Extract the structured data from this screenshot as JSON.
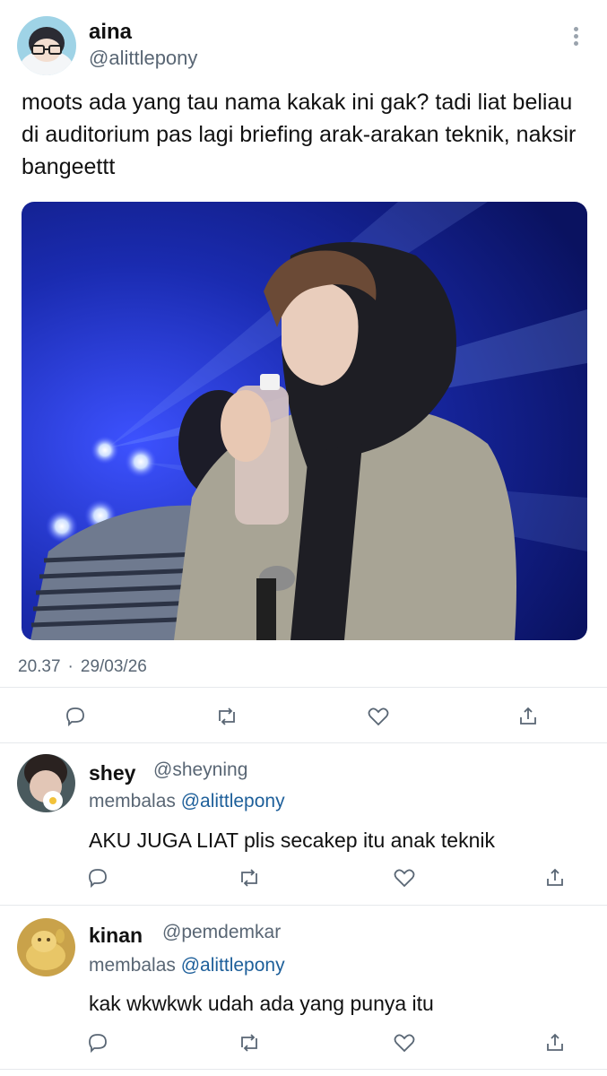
{
  "tweet": {
    "author_name": "aina",
    "author_handle": "@alittlepony",
    "text": "moots ada yang tau nama kakak ini gak? tadi liat beliau di auditorium pas lagi briefing arak-arakan teknik, naksir bangeettt",
    "time": "20.37",
    "separator": "·",
    "date": "29/03/26"
  },
  "actions": [
    "reply-icon",
    "retweet-icon",
    "like-icon",
    "share-icon"
  ],
  "replies": [
    {
      "author_name": "shey",
      "author_handle": "@sheyning",
      "replying_prefix": "membalas",
      "replying_to": "@alittlepony",
      "text": "AKU JUGA LIAT plis secakep itu anak teknik"
    },
    {
      "author_name": "kinan",
      "author_handle": "@pemdemkar",
      "replying_prefix": "membalas",
      "replying_to": "@alittlepony",
      "text": "kak wkwkwk udah ada yang punya itu"
    }
  ],
  "colors": {
    "text": "#111111",
    "secondary": "#596674",
    "mention": "#1d5f9a",
    "divider": "#e6e9ec",
    "stage_blue": "#1a2bb0"
  }
}
